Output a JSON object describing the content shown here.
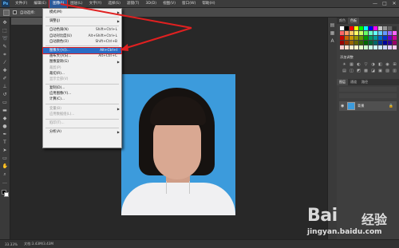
{
  "app": {
    "logo": "Ps"
  },
  "menubar": {
    "items": [
      "文件(F)",
      "编辑(E)",
      "图像(I)",
      "图层(L)",
      "文字(Y)",
      "选择(S)",
      "滤镜(T)",
      "3D(D)",
      "视图(V)",
      "窗口(W)",
      "帮助(H)"
    ],
    "active_index": 2,
    "window_controls": [
      "—",
      "□",
      "✕"
    ]
  },
  "options_bar": {
    "auto_select_label": "自动选择:"
  },
  "document_tab": {
    "title": ""
  },
  "image_menu": {
    "items": [
      {
        "label": "模式(M)",
        "shortcut": "",
        "submenu": true,
        "disabled": false
      },
      {
        "sep": true
      },
      {
        "label": "调整(J)",
        "shortcut": "",
        "submenu": true,
        "disabled": false
      },
      {
        "sep": true
      },
      {
        "label": "自动色调(N)",
        "shortcut": "Shift+Ctrl+L",
        "disabled": false
      },
      {
        "label": "自动对比度(U)",
        "shortcut": "Alt+Shift+Ctrl+L",
        "disabled": false
      },
      {
        "label": "自动颜色(O)",
        "shortcut": "Shift+Ctrl+B",
        "disabled": false
      },
      {
        "sep": true
      },
      {
        "label": "图像大小(I)...",
        "shortcut": "Alt+Ctrl+I",
        "disabled": false,
        "highlight": true
      },
      {
        "label": "画布大小(S)...",
        "shortcut": "Alt+Ctrl+C",
        "disabled": false
      },
      {
        "label": "图像旋转(G)",
        "shortcut": "",
        "submenu": true,
        "disabled": false
      },
      {
        "label": "裁剪(P)",
        "shortcut": "",
        "disabled": true
      },
      {
        "label": "裁切(R)...",
        "shortcut": "",
        "disabled": false
      },
      {
        "label": "显示全部(V)",
        "shortcut": "",
        "disabled": true
      },
      {
        "sep": true
      },
      {
        "label": "复制(D)...",
        "shortcut": "",
        "disabled": false
      },
      {
        "label": "应用图像(Y)...",
        "shortcut": "",
        "disabled": false
      },
      {
        "label": "计算(C)...",
        "shortcut": "",
        "disabled": false
      },
      {
        "sep": true
      },
      {
        "label": "变量(B)",
        "shortcut": "",
        "submenu": true,
        "disabled": true
      },
      {
        "label": "应用数据组(L)...",
        "shortcut": "",
        "disabled": true
      },
      {
        "sep": true
      },
      {
        "label": "陷印(T)...",
        "shortcut": "",
        "disabled": true
      },
      {
        "sep": true
      },
      {
        "label": "分析(A)",
        "shortcut": "",
        "submenu": true,
        "disabled": false
      }
    ]
  },
  "panels": {
    "color_tabs": [
      "颜色",
      "色板"
    ],
    "swatch_colors": [
      "#ffffff",
      "#000000",
      "#ff0000",
      "#ffff00",
      "#00ff00",
      "#00ffff",
      "#0000ff",
      "#ff00ff",
      "#c8c8c8",
      "#969696",
      "#646464",
      "#323232",
      "#ff6666",
      "#ff9966",
      "#ffcc66",
      "#ffff66",
      "#ccff66",
      "#66ff66",
      "#66ffcc",
      "#66ffff",
      "#66ccff",
      "#6699ff",
      "#9966ff",
      "#ff66ff",
      "#cc0000",
      "#cc6600",
      "#cc9900",
      "#999900",
      "#669900",
      "#009900",
      "#009966",
      "#009999",
      "#0066cc",
      "#0033cc",
      "#6600cc",
      "#cc0099",
      "#990000",
      "#993300",
      "#996600",
      "#666600",
      "#336600",
      "#006600",
      "#006633",
      "#006666",
      "#003399",
      "#000099",
      "#330099",
      "#990066",
      "#ffcccc",
      "#ffe0cc",
      "#fff0cc",
      "#ffffcc",
      "#e6ffcc",
      "#ccffcc",
      "#ccffe6",
      "#ccffff",
      "#cce6ff",
      "#ccd6ff",
      "#e0ccff",
      "#ffccf0"
    ],
    "adjustments_title": "添加调整",
    "adjust_icons": [
      "☀",
      "▦",
      "◐",
      "▽",
      "◑",
      "◧",
      "◉",
      "⊞",
      "▤",
      "◫",
      "◩",
      "▩",
      "◪",
      "▣",
      "▨",
      "▥"
    ],
    "layer_tabs": [
      "图层",
      "通道",
      "路径"
    ],
    "layer_rows": [
      "",
      ""
    ],
    "background_layer": "背景"
  },
  "status": {
    "zoom": "33.33%",
    "doc": "文档:3.43M/3.43M"
  },
  "watermark": {
    "logo": "Bai",
    "cn": "经验",
    "url": "jingyan.baidu.com"
  },
  "colors": {
    "highlight": "#2b6cc4",
    "annotation": "#e02020",
    "photo_bg": "#3c9bdc"
  }
}
